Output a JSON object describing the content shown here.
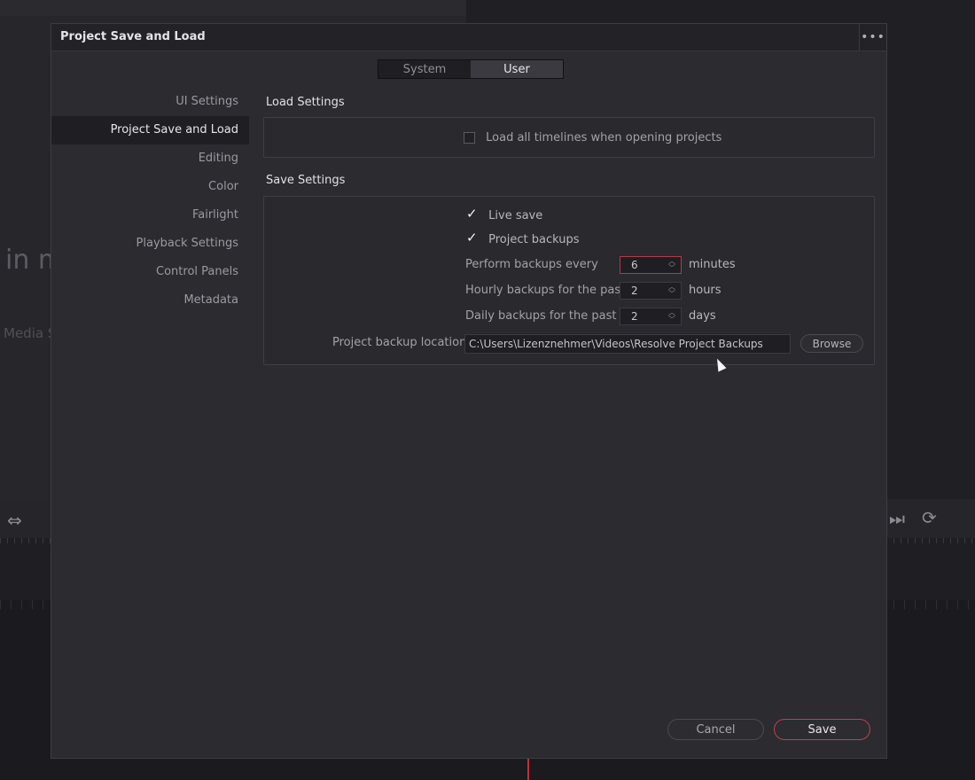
{
  "background": {
    "large_text": "in m",
    "small_text": "Media S"
  },
  "dialog": {
    "title": "Project Save and Load",
    "more_icon": "more-horizontal-icon"
  },
  "tabs": [
    {
      "label": "System",
      "selected": false
    },
    {
      "label": "User",
      "selected": true
    }
  ],
  "sidebar": {
    "items": [
      {
        "label": "UI Settings",
        "active": false
      },
      {
        "label": "Project Save and Load",
        "active": true
      },
      {
        "label": "Editing",
        "active": false
      },
      {
        "label": "Color",
        "active": false
      },
      {
        "label": "Fairlight",
        "active": false
      },
      {
        "label": "Playback Settings",
        "active": false
      },
      {
        "label": "Control Panels",
        "active": false
      },
      {
        "label": "Metadata",
        "active": false
      }
    ]
  },
  "load_settings": {
    "title": "Load Settings",
    "load_all_timelines": {
      "label": "Load all timelines when opening projects",
      "checked": false
    }
  },
  "save_settings": {
    "title": "Save Settings",
    "live_save": {
      "label": "Live save",
      "checked": true
    },
    "project_backups": {
      "label": "Project backups",
      "checked": true
    },
    "perform_backups": {
      "label": "Perform backups every",
      "value": "6",
      "unit": "minutes"
    },
    "hourly_backups": {
      "label": "Hourly backups for the past",
      "value": "2",
      "unit": "hours"
    },
    "daily_backups": {
      "label": "Daily backups for the past",
      "value": "2",
      "unit": "days"
    },
    "backup_location": {
      "label": "Project backup location",
      "value": "C:\\Users\\Lizenznehmer\\Videos\\Resolve Project Backups",
      "browse_label": "Browse"
    }
  },
  "footer": {
    "cancel_label": "Cancel",
    "save_label": "Save"
  },
  "colors": {
    "accent": "#c4404f",
    "dialog_bg": "#2b2b30"
  }
}
